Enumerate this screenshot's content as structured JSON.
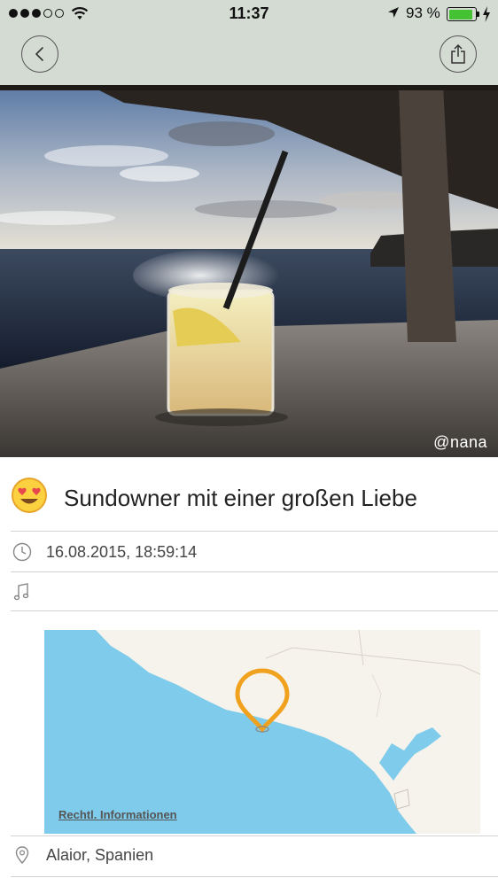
{
  "status_bar": {
    "time": "11:37",
    "battery_percent": "93 %",
    "battery_level": 0.93,
    "signal_bars_filled": 3,
    "signal_bars_total": 5,
    "battery_color": "#45c234"
  },
  "header": {
    "background": "#d4dbd3",
    "back_icon": "chevron-left-icon",
    "share_icon": "share-icon"
  },
  "photo": {
    "credit": "@nana"
  },
  "entry": {
    "mood_icon": "heart-eyes-emoji-icon",
    "title": "Sundowner mit einer großen Liebe",
    "datetime": "16.08.2015, 18:59:14",
    "music": "",
    "location": "Alaior, Spanien"
  },
  "map": {
    "legal_link": "Rechtl. Informationen",
    "pin_color": "#f0a11e",
    "water_color": "#7fcbeb",
    "land_color": "#f6f3ec"
  }
}
